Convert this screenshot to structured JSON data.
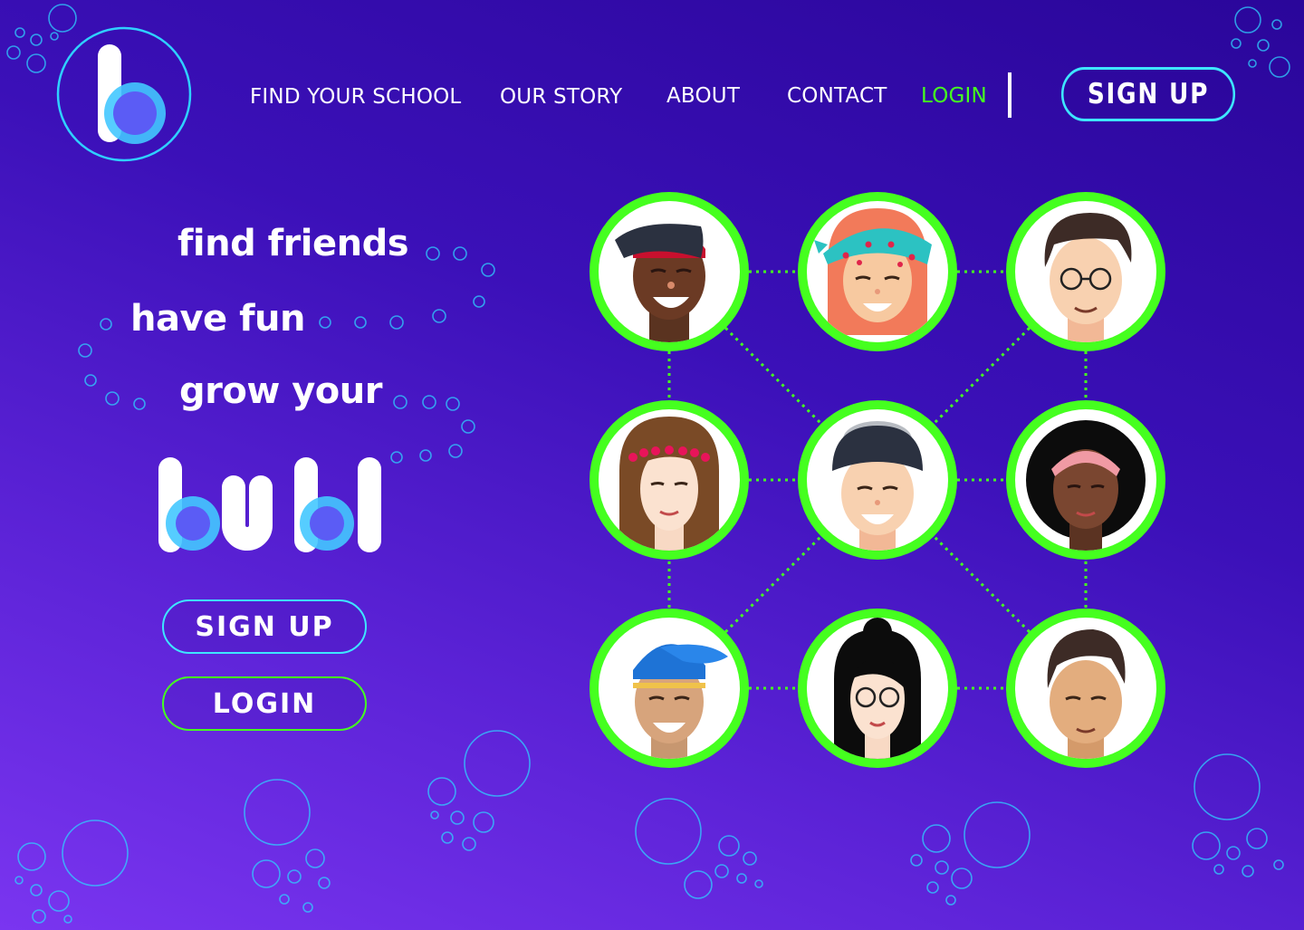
{
  "nav": {
    "links": [
      "FIND YOUR SCHOOL",
      "OUR STORY",
      "ABOUT",
      "CONTACT"
    ],
    "login": "LOGIN",
    "signup": "SIGN UP"
  },
  "hero": {
    "taglines": [
      "find friends",
      "have fun",
      "grow your"
    ],
    "signup": "SIGN UP",
    "login": "LOGIN"
  },
  "brand": {
    "logo_letter": "b",
    "wordmark": "bubl",
    "colors": {
      "accent_cyan": "#3ee6ff",
      "accent_green": "#45ff1f",
      "bubble_blue": "#5b5cf5",
      "bg_dark": "#2a069a",
      "bg_light": "#7a35f0"
    }
  },
  "avatars": [
    {
      "name": "boy-with-red-cap-avatar"
    },
    {
      "name": "girl-with-bandana-avatar"
    },
    {
      "name": "boy-with-glasses-avatar"
    },
    {
      "name": "girl-with-flower-crown-avatar"
    },
    {
      "name": "boy-with-beanie-avatar"
    },
    {
      "name": "girl-with-headband-avatar"
    },
    {
      "name": "boy-with-blue-cap-avatar"
    },
    {
      "name": "girl-with-bun-and-glasses-avatar"
    },
    {
      "name": "boy-with-quiff-avatar"
    }
  ]
}
